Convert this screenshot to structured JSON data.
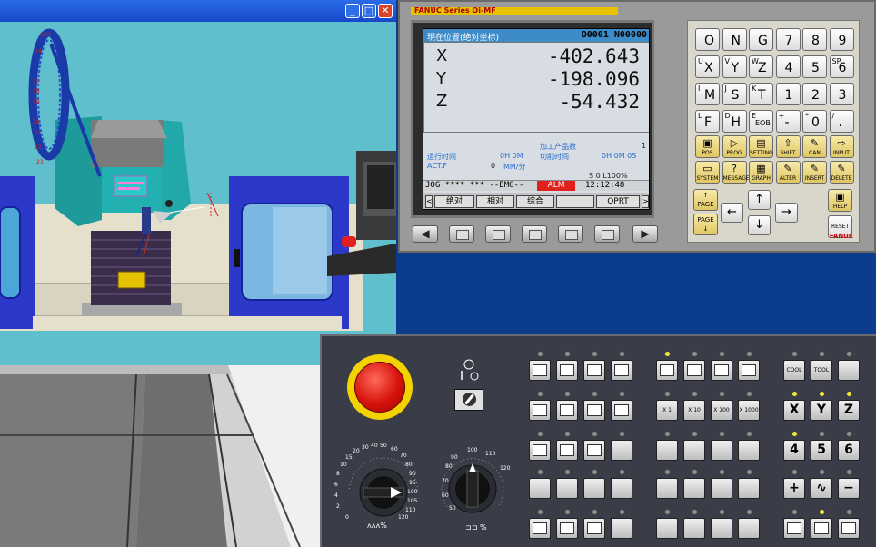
{
  "window": {
    "minimize": "_",
    "maximize": "□",
    "close": "✕"
  },
  "cnc": {
    "brand": "FANUC Series Oi-MF",
    "screen": {
      "title": "現在位置(绝对坐标)",
      "program": "O0001 N00000",
      "axes": [
        {
          "letter": "X",
          "value": "-402.643"
        },
        {
          "letter": "Y",
          "value": "-198.096"
        },
        {
          "letter": "Z",
          "value": "-54.432"
        }
      ],
      "parts_label": "加工产品数",
      "parts_value": "1",
      "run_label": "运行时间",
      "run_value": "0H  0M",
      "cycle_label": "切削时间",
      "cycle_value": "0H  0M  0S",
      "actf_label": "ACT.F",
      "actf_value": "0",
      "actf_unit": "MM/分",
      "spindle": "S    0  L100%",
      "mode": "JOG **** *** --EMG--",
      "alarm": "ALM",
      "time": "12:12:48",
      "softkeys": [
        "绝对",
        "相对",
        "综合",
        "",
        "OPRT"
      ],
      "arrow_left": "<",
      "arrow_right": ">"
    },
    "soft_left": "◀",
    "soft_right": "▶",
    "brand_small": "FANUC",
    "mdi_keys": [
      {
        "sup": "",
        "main": "O"
      },
      {
        "sup": "",
        "main": "N"
      },
      {
        "sup": "",
        "main": "G"
      },
      {
        "sup": "",
        "main": "7"
      },
      {
        "sup": "",
        "main": "8"
      },
      {
        "sup": "",
        "main": "9"
      },
      {
        "sup": "U",
        "main": "X"
      },
      {
        "sup": "V",
        "main": "Y"
      },
      {
        "sup": "W",
        "main": "Z"
      },
      {
        "sup": "",
        "main": "4"
      },
      {
        "sup": "",
        "main": "5"
      },
      {
        "sup": "SP",
        "main": "6"
      },
      {
        "sup": "I",
        "main": "M"
      },
      {
        "sup": "J",
        "main": "S"
      },
      {
        "sup": "K",
        "main": "T"
      },
      {
        "sup": "",
        "main": "1"
      },
      {
        "sup": "",
        "main": "2"
      },
      {
        "sup": "",
        "main": "3"
      },
      {
        "sup": "L",
        "main": "F"
      },
      {
        "sup": "D",
        "main": "H"
      },
      {
        "sup": "E",
        "main": "EOB"
      },
      {
        "sup": "+",
        "main": "-"
      },
      {
        "sup": "*",
        "main": "0"
      },
      {
        "sup": "/",
        "main": "."
      }
    ],
    "func_keys": [
      {
        "label": "POS",
        "glyph": "▣"
      },
      {
        "label": "PROG",
        "glyph": "▷"
      },
      {
        "label": "SETTING",
        "glyph": "▤"
      },
      {
        "label": "SHIFT",
        "glyph": "⇧"
      },
      {
        "label": "CAN",
        "glyph": "✎"
      },
      {
        "label": "INPUT",
        "glyph": "⇨"
      },
      {
        "label": "SYSTEM",
        "glyph": "▭"
      },
      {
        "label": "MESSAGE",
        "glyph": "?"
      },
      {
        "label": "GRAPH",
        "glyph": "▦"
      },
      {
        "label": "ALTER",
        "glyph": "✎"
      },
      {
        "label": "INSERT",
        "glyph": "✎"
      },
      {
        "label": "DELETE",
        "glyph": "✎"
      }
    ],
    "page_up": "↑ PAGE",
    "page_down": "PAGE ↓",
    "help": "HELP",
    "reset": "RESET",
    "arrows": {
      "up": "↑",
      "down": "↓",
      "left": "←",
      "right": "→"
    }
  },
  "ops": {
    "buttons": {
      "cool": "COOL",
      "tool": "TOOL",
      "x1": "X 1",
      "x10": "X 10",
      "x100": "X 100",
      "x1000": "X 1000",
      "axis_x": "X",
      "axis_y": "Y",
      "axis_z": "Z",
      "n4": "4",
      "n5": "5",
      "n6": "6",
      "plus": "+",
      "rapid": "∿",
      "minus": "−"
    },
    "feed_dial": {
      "ticks": [
        "0",
        "2",
        "4",
        "6",
        "8",
        "10",
        "15",
        "20",
        "30",
        "40",
        "50",
        "60",
        "70",
        "80",
        "90",
        "95",
        "100",
        "105",
        "110",
        "120"
      ],
      "symbol": "ᴧᴧᴧ%"
    },
    "spindle_dial": {
      "ticks": [
        "50",
        "60",
        "70",
        "80",
        "90",
        "100",
        "110",
        "120"
      ],
      "symbol": "⊐⊐ %"
    }
  },
  "sim": {
    "ruler_labels": [
      "150",
      "14",
      "17",
      "18",
      "19",
      "20",
      "21",
      "22",
      "23"
    ]
  }
}
